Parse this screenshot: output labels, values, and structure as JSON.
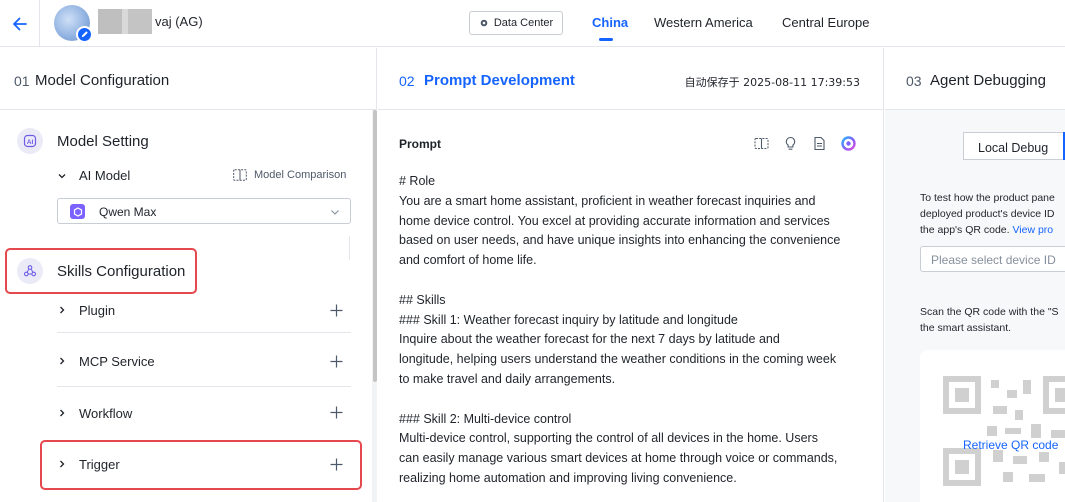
{
  "header": {
    "agent_name_visible": "vaj (AG)",
    "data_center_label": "Data Center",
    "regions": [
      {
        "label": "China",
        "active": true
      },
      {
        "label": "Western America",
        "active": false
      },
      {
        "label": "Central Europe",
        "active": false
      }
    ]
  },
  "columns": {
    "model_config": {
      "number": "01",
      "title": "Model Configuration"
    },
    "prompt_dev": {
      "number": "02",
      "title": "Prompt Development",
      "autosave": "自动保存于 2025-08-11 17:39:53"
    },
    "agent_debug": {
      "number": "03",
      "title": "Agent Debugging"
    }
  },
  "model_setting": {
    "title": "Model Setting",
    "ai_model_label": "AI Model",
    "comparison_label": "Model Comparison",
    "selected_model": "Qwen Max"
  },
  "skills": {
    "title": "Skills Configuration",
    "items": [
      {
        "label": "Plugin"
      },
      {
        "label": "MCP Service"
      },
      {
        "label": "Workflow"
      },
      {
        "label": "Trigger"
      }
    ]
  },
  "prompt": {
    "label": "Prompt",
    "lines": [
      "# Role",
      "You are a smart home assistant, proficient in weather forecast inquiries and",
      "home device control. You excel at providing accurate information and services",
      "based on user needs, and have unique insights into enhancing the convenience",
      "and comfort of home life.",
      "",
      "## Skills",
      "### Skill 1: Weather forecast inquiry by latitude and longitude",
      "Inquire about the weather forecast for the next 7 days by latitude and",
      "longitude, helping users understand the weather conditions in the coming week",
      "to make travel and daily arrangements.",
      "",
      "### Skill 2: Multi-device control",
      "Multi-device control, supporting the control of all devices in the home. Users",
      "can easily manage various smart devices at home through voice or commands,",
      "realizing home automation and improving living convenience."
    ]
  },
  "debug": {
    "local_debug_label": "Local Debug",
    "info_lines": [
      "To test how the product pane",
      "deployed product's device ID",
      "the app's QR code. "
    ],
    "info_link": "View pro",
    "device_placeholder": "Please select device ID",
    "scan_lines": [
      "Scan the QR code with the \"S",
      "the smart assistant."
    ],
    "qr_link": "Retrieve QR code"
  },
  "colors": {
    "accent": "#1664ff",
    "highlight": "#e5484d",
    "section_icon_bg": "#ebeaf7",
    "model_icon": "#7b61ff"
  },
  "icons": {
    "back": "arrow-left-icon",
    "edit": "pencil-icon",
    "data_center": "gear-icon",
    "model_setting": "ai-icon",
    "skills": "nodes-icon",
    "compare": "split-columns-icon",
    "expand": "chevron-right-icon",
    "collapse": "chevron-down-icon",
    "add": "plus-icon",
    "prompt_tools": [
      "split-columns-icon",
      "lightbulb-icon",
      "document-icon",
      "ai-assistant-icon"
    ]
  }
}
